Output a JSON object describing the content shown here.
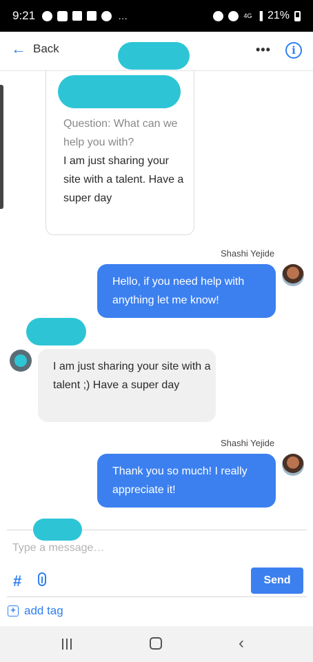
{
  "status_bar": {
    "time": "9:21",
    "network": "4G",
    "battery": "21%",
    "overflow": "…"
  },
  "header": {
    "back_label": "Back",
    "more_glyph": "•••",
    "info_glyph": "i"
  },
  "form_card": {
    "question": "Question: What can we help you with?",
    "answer": "I am just sharing your site with a talent. Have a super day"
  },
  "messages": [
    {
      "sender": "Shashi Yejide",
      "text": "Hello, if you need help with anything let me know!"
    },
    {
      "sender": "",
      "text": "I am just sharing your site with a talent ;) Have a super day"
    },
    {
      "sender": "Shashi Yejide",
      "text": "Thank you so much! I really appreciate it!"
    }
  ],
  "composer": {
    "placeholder": "Type a message…",
    "hash": "#",
    "send_label": "Send",
    "add_tag_label": "add tag"
  },
  "colors": {
    "accent": "#3c80f0",
    "redaction": "#2dc5d6"
  }
}
